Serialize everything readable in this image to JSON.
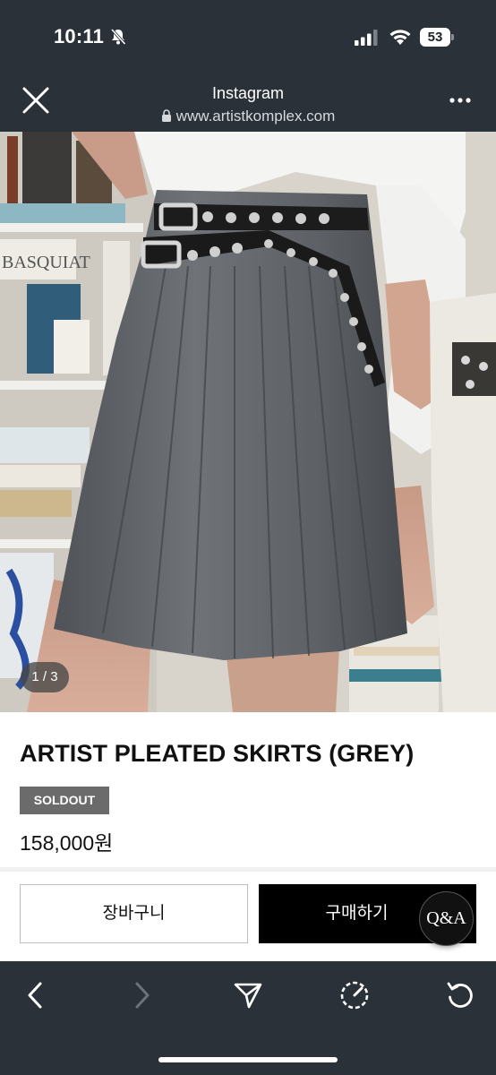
{
  "status_bar": {
    "time": "10:11",
    "battery_level": "53",
    "icons": [
      "bell-slash-icon",
      "signal-icon",
      "wifi-icon",
      "battery-icon"
    ]
  },
  "browser_header": {
    "title": "Instagram",
    "url": "www.artistkomplex.com",
    "icons": [
      "close-icon",
      "lock-icon",
      "more-icon"
    ]
  },
  "product": {
    "image_counter": "1 / 3",
    "title": "ARTIST PLEATED SKIRTS (GREY)",
    "badge": "SOLDOUT",
    "price": "158,000원"
  },
  "actions": {
    "cart_label": "장바구니",
    "buy_label": "구매하기",
    "qa_label": "Q&A"
  },
  "toolbar": {
    "icons": [
      "back-arrow-icon",
      "forward-arrow-icon",
      "share-send-icon",
      "compass-icon",
      "reload-icon"
    ]
  },
  "colors": {
    "chrome_bg": "#2b3139",
    "buy_bg": "#000000",
    "badge_bg": "#6b6b6b"
  }
}
